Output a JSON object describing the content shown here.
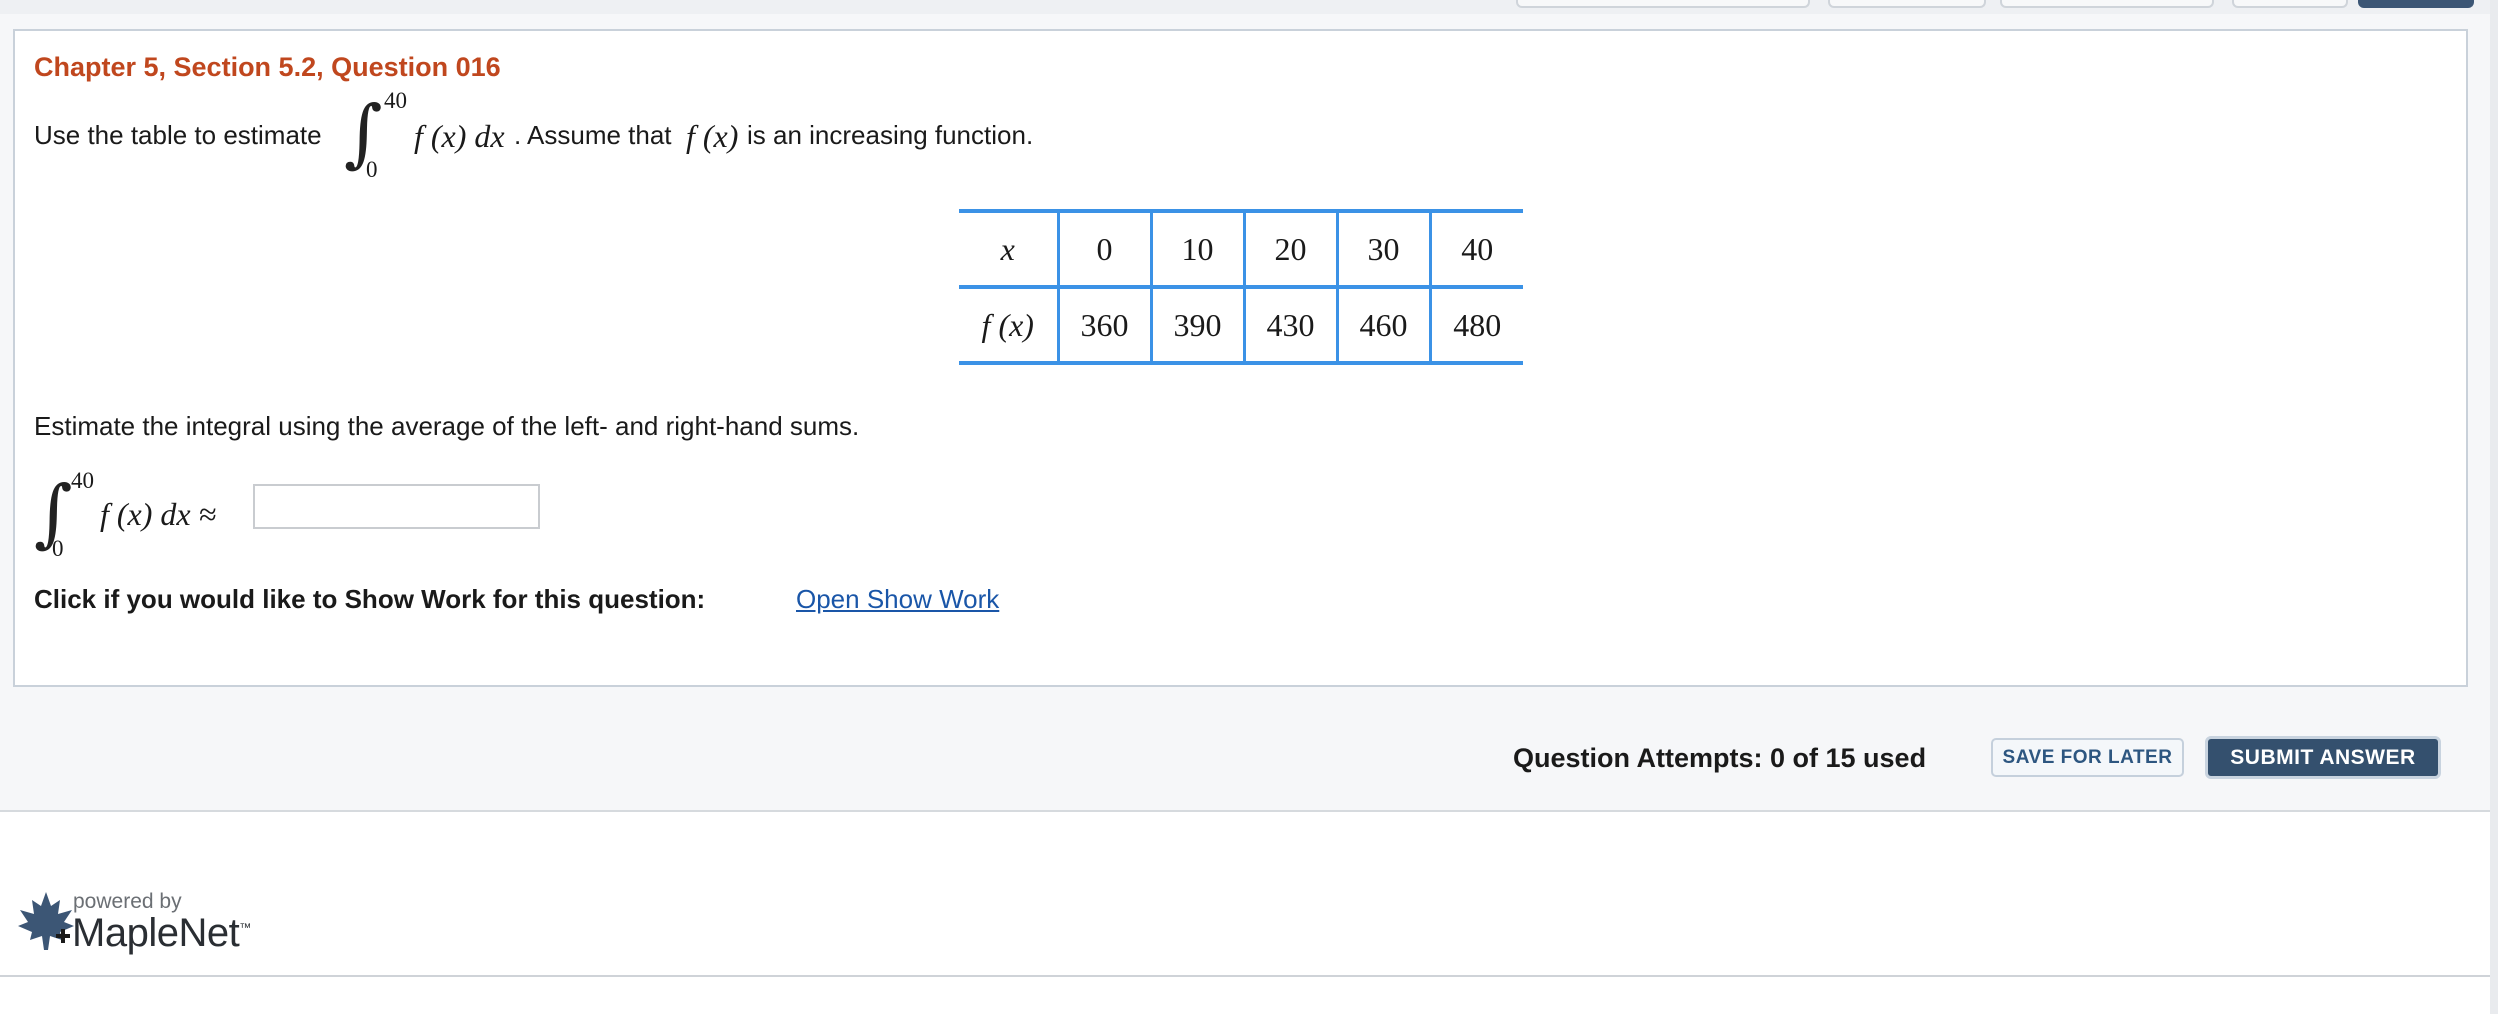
{
  "question": {
    "title": "Chapter 5, Section 5.2, Question 016",
    "prompt_prefix": "Use the table to estimate",
    "integral_upper": "40",
    "integral_lower": "0",
    "integrand": "f (x) dx",
    "prompt_middle": ". Assume that",
    "function_name": "f (x)",
    "prompt_suffix": "is an increasing function.",
    "table": {
      "row_labels": [
        "x",
        "f (x)"
      ],
      "x_values": [
        "0",
        "10",
        "20",
        "30",
        "40"
      ],
      "fx_values": [
        "360",
        "390",
        "430",
        "460",
        "480"
      ]
    },
    "estimate_instruction": "Estimate the integral using the average of the left- and right-hand sums.",
    "answer_expression": "f (x) dx ≈",
    "answer_value": "",
    "show_work_label": "Click if you would like to Show Work for this question:",
    "show_work_link": "Open Show Work"
  },
  "footer_actions": {
    "attempts": "Question Attempts: 0 of 15 used",
    "save_label": "SAVE FOR LATER",
    "submit_label": "SUBMIT ANSWER"
  },
  "branding": {
    "powered_by": "powered by",
    "name": "MapleNet",
    "trademark": "™",
    "logo_icon": "maple-leaf-icon"
  },
  "colors": {
    "title": "#c0471e",
    "table_border": "#3b92e6",
    "link": "#1a56a8",
    "submit_bg": "#34506e"
  }
}
